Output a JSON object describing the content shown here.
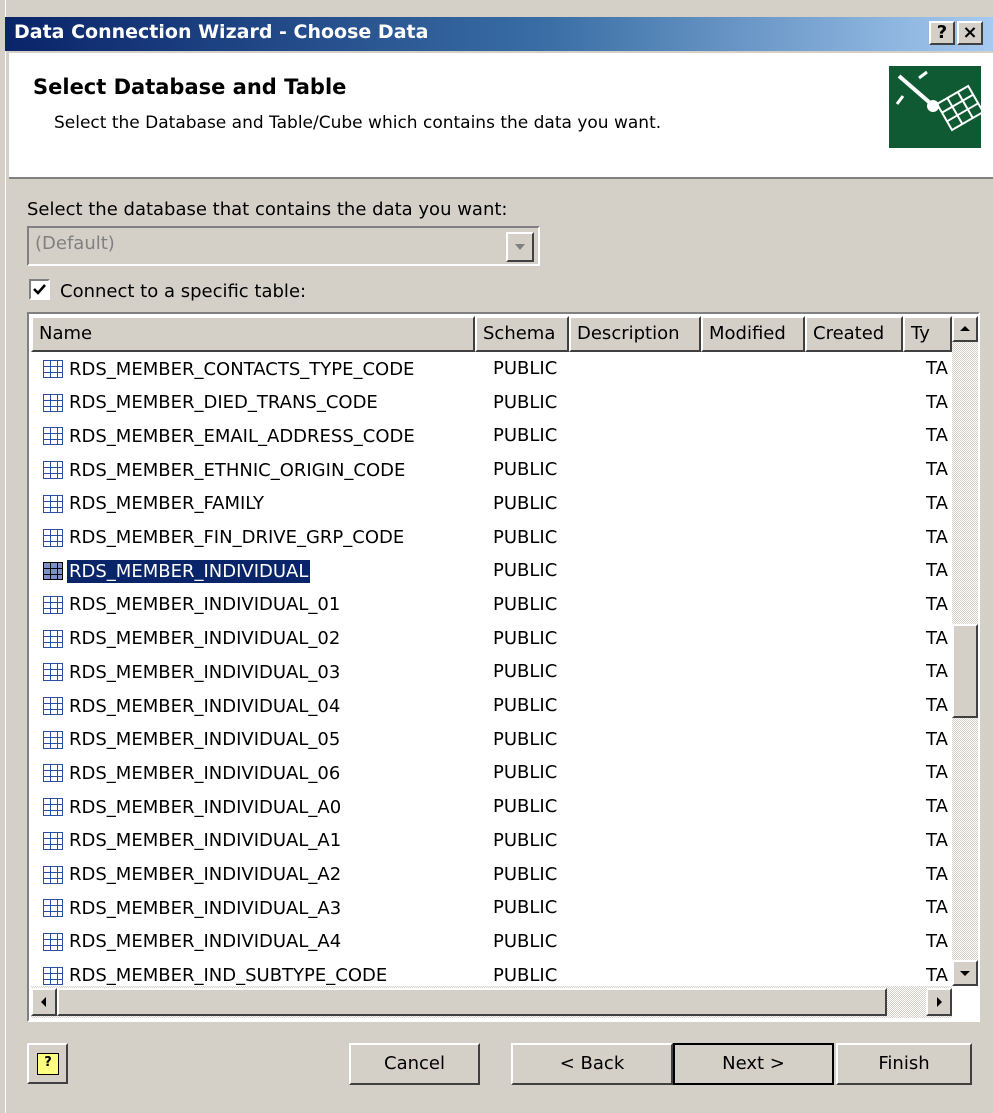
{
  "window": {
    "title": "Data Connection Wizard - Choose Data",
    "help_button": "?",
    "close_button": "×"
  },
  "header": {
    "title": "Select Database and Table",
    "subtitle": "Select the Database and Table/Cube which contains the data you want."
  },
  "database": {
    "label": "Select the database that contains the data you want:",
    "value": "(Default)",
    "enabled": false
  },
  "specific_table": {
    "label": "Connect to a specific table:",
    "checked": true
  },
  "table_list": {
    "columns": [
      "Name",
      "Schema",
      "Description",
      "Modified",
      "Created",
      "Ty"
    ],
    "selected_index": 6,
    "rows": [
      {
        "name": "RDS_MEMBER_CONTACTS_TYPE_CODE",
        "schema": "PUBLIC",
        "type": "TA"
      },
      {
        "name": "RDS_MEMBER_DIED_TRANS_CODE",
        "schema": "PUBLIC",
        "type": "TA"
      },
      {
        "name": "RDS_MEMBER_EMAIL_ADDRESS_CODE",
        "schema": "PUBLIC",
        "type": "TA"
      },
      {
        "name": "RDS_MEMBER_ETHNIC_ORIGIN_CODE",
        "schema": "PUBLIC",
        "type": "TA"
      },
      {
        "name": "RDS_MEMBER_FAMILY",
        "schema": "PUBLIC",
        "type": "TA"
      },
      {
        "name": "RDS_MEMBER_FIN_DRIVE_GRP_CODE",
        "schema": "PUBLIC",
        "type": "TA"
      },
      {
        "name": "RDS_MEMBER_INDIVIDUAL",
        "schema": "PUBLIC",
        "type": "TA"
      },
      {
        "name": "RDS_MEMBER_INDIVIDUAL_01",
        "schema": "PUBLIC",
        "type": "TA"
      },
      {
        "name": "RDS_MEMBER_INDIVIDUAL_02",
        "schema": "PUBLIC",
        "type": "TA"
      },
      {
        "name": "RDS_MEMBER_INDIVIDUAL_03",
        "schema": "PUBLIC",
        "type": "TA"
      },
      {
        "name": "RDS_MEMBER_INDIVIDUAL_04",
        "schema": "PUBLIC",
        "type": "TA"
      },
      {
        "name": "RDS_MEMBER_INDIVIDUAL_05",
        "schema": "PUBLIC",
        "type": "TA"
      },
      {
        "name": "RDS_MEMBER_INDIVIDUAL_06",
        "schema": "PUBLIC",
        "type": "TA"
      },
      {
        "name": "RDS_MEMBER_INDIVIDUAL_A0",
        "schema": "PUBLIC",
        "type": "TA"
      },
      {
        "name": "RDS_MEMBER_INDIVIDUAL_A1",
        "schema": "PUBLIC",
        "type": "TA"
      },
      {
        "name": "RDS_MEMBER_INDIVIDUAL_A2",
        "schema": "PUBLIC",
        "type": "TA"
      },
      {
        "name": "RDS_MEMBER_INDIVIDUAL_A3",
        "schema": "PUBLIC",
        "type": "TA"
      },
      {
        "name": "RDS_MEMBER_INDIVIDUAL_A4",
        "schema": "PUBLIC",
        "type": "TA"
      },
      {
        "name": "RDS_MEMBER_IND_SUBTYPE_CODE",
        "schema": "PUBLIC",
        "type": "TA"
      }
    ]
  },
  "buttons": {
    "help": "?",
    "cancel": "Cancel",
    "back": "< Back",
    "next": "Next >",
    "finish": "Finish"
  }
}
